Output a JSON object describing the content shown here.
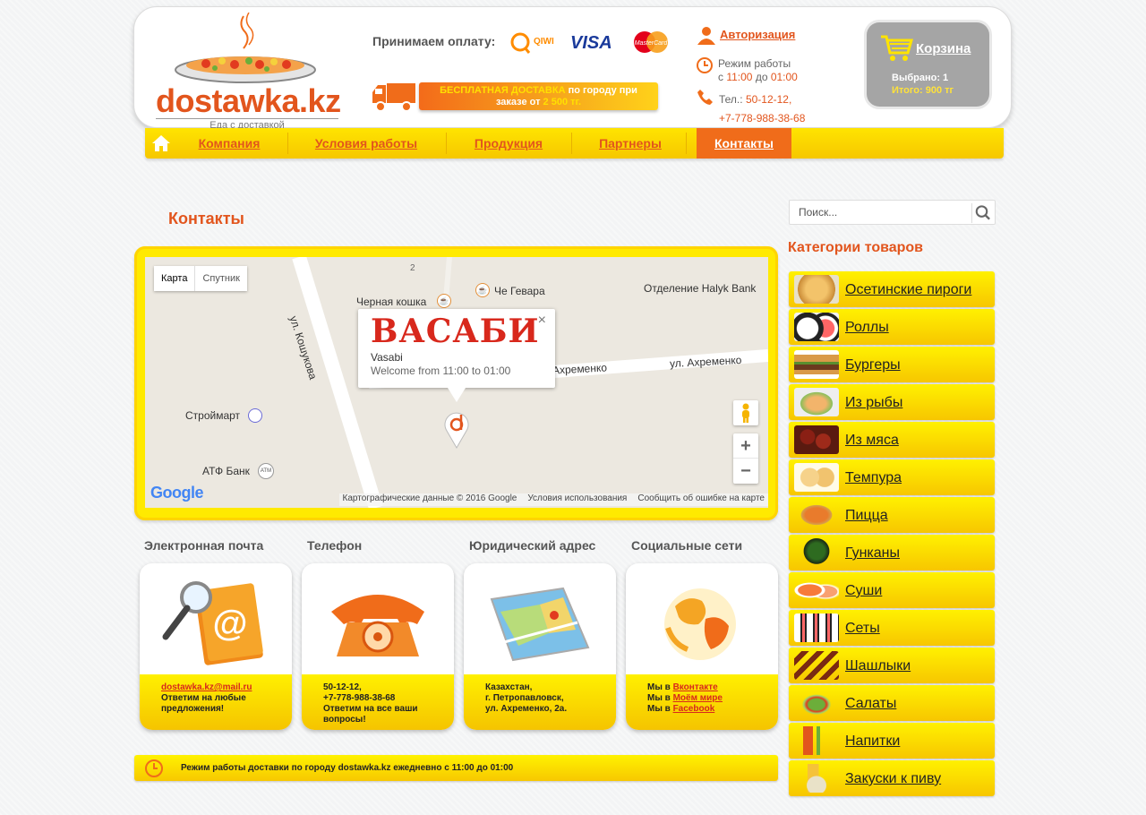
{
  "header": {
    "logo_text": "dostawka.kz",
    "logo_subtitle": "Еда с доставкой",
    "payment_label": "Принимаем оплату:",
    "payment_methods": {
      "qiwi": "QIWI",
      "visa": "VISA",
      "mastercard": "MasterCard"
    },
    "free_delivery": {
      "part1": "БЕСПЛАТНАЯ ДОСТАВКА",
      "part2": " по городу при",
      "part3": "заказе от ",
      "amount": "2 500 тг."
    },
    "auth_link": "Авторизация",
    "work_hours": {
      "label": "Режим работы",
      "from_prefix": "с ",
      "from": "11:00",
      "to_prefix": " до ",
      "to": "01:00"
    },
    "phones": {
      "label": "Тел.: ",
      "phone1": "50-12-12,",
      "phone2": "+7-778-988-38-68"
    },
    "cart": {
      "title": "Корзина",
      "selected": "Выбрано: 1",
      "total": "Итого: 900 тг"
    }
  },
  "nav": {
    "items": [
      {
        "label": "Компания"
      },
      {
        "label": "Условия работы"
      },
      {
        "label": "Продукция"
      },
      {
        "label": "Партнеры"
      },
      {
        "label": "Контакты",
        "active": true
      }
    ]
  },
  "page_title": "Контакты",
  "map": {
    "type_map": "Карта",
    "type_satellite": "Спутник",
    "labels": {
      "black_cat": "Черная кошка",
      "che_guevara": "Че Гевара",
      "halyk": "Отделение Halyk Bank",
      "koshukova": "ул. Кошукова",
      "akhremenko_short": "Ахременко",
      "akhremenko": "ул. Ахременко",
      "stroymart": "Строймарт",
      "atf": "АТФ Банк",
      "num2": "2"
    },
    "popup": {
      "logo": "ВАСАБИ",
      "name": "Vasabi",
      "hours": "Welcome from 11:00 to 01:00",
      "close": "×"
    },
    "zoom_in": "+",
    "zoom_out": "−",
    "google": "Google",
    "attribution": [
      "Картографические данные © 2016 Google",
      "Условия использования",
      "Сообщить об ошибке на карте"
    ]
  },
  "cards": [
    {
      "heading": "Электронная почта",
      "lines": [
        "dostawka.kz@mail.ru",
        "Ответим на любые",
        "предложения!"
      ]
    },
    {
      "heading": "Телефон",
      "lines": [
        "50-12-12,",
        "+7-778-988-38-68",
        "Ответим на все ваши",
        "вопросы!"
      ]
    },
    {
      "heading": "Юридический адрес",
      "lines": [
        "Казахстан,",
        "г. Петропавловск,",
        "ул. Ахременко, 2а."
      ]
    },
    {
      "heading": "Социальные сети",
      "prefix": "Мы в ",
      "links": [
        "Вконтакте",
        "Моём мире",
        "Facebook"
      ]
    }
  ],
  "hours_bar": "Режим работы доставки по городу dostawka.kz ежедневно с 11:00 до 01:00",
  "sidebar": {
    "search_placeholder": "Поиск...",
    "categories_title": "Категории товаров",
    "categories": [
      "Осетинские пироги",
      "Роллы",
      "Бургеры",
      "Из рыбы",
      "Из мяса",
      "Темпура",
      "Пицца",
      "Гунканы",
      "Суши",
      "Сеты",
      "Шашлыки",
      "Салаты",
      "Напитки",
      "Закуски к пиву"
    ]
  },
  "colors": {
    "accent": "#e2551d",
    "yellow": "#ffe400",
    "cart_bg": "#a5a5a5"
  }
}
